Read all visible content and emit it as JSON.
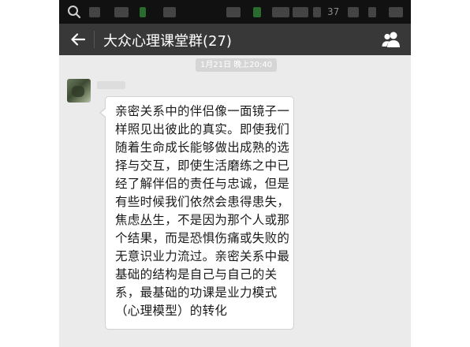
{
  "app": {
    "title": "大众心理课堂群(27)"
  },
  "statusbar": {
    "left_text": "",
    "right_text": "37"
  },
  "chat": {
    "timestamp": "1月21日 晚上20:40",
    "messages": [
      {
        "lines": [
          "亲密关系中的伴侣像一面镜子一",
          "样照见出彼此的真实。即使我们",
          "随着生命成长能够做出成熟的选",
          "择与交互，即使生活磨练之中已",
          "经了解伴侣的责任与忠诚，但是",
          "有些时候我们依然会患得患失，",
          "焦虑丛生，不是因为那个人或那",
          "个结果，而是恐惧伤痛或失败的",
          "无意识业力流过。亲密关系中最",
          "基础的结构是自己与自己的关",
          "系，最基础的功课是业力模式",
          "（心理模型）的转化"
        ]
      }
    ]
  },
  "colors": {
    "titlebar": "#383838",
    "statusbar": "#111111",
    "chat_bg": "#ebebeb",
    "bubble": "#ffffff"
  },
  "icons": {
    "back": "back-arrow-icon",
    "group": "group-members-icon",
    "search": "search-icon"
  }
}
